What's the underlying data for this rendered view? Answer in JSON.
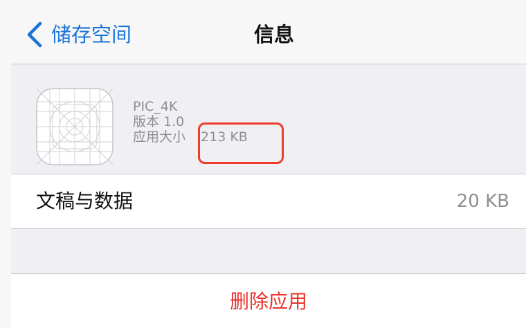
{
  "nav": {
    "back_label": "储存空间",
    "title": "信息"
  },
  "app": {
    "name": "PIC_4K",
    "version": "版本 1.0",
    "size_label": "应用大小",
    "size_value": "213 KB"
  },
  "documents": {
    "label": "文稿与数据",
    "value": "20 KB"
  },
  "actions": {
    "delete_label": "删除应用"
  },
  "icons": {
    "back": "chevron-left-icon",
    "app": "app-placeholder-icon"
  },
  "colors": {
    "accent": "#1a74d8",
    "destructive": "#e9322b",
    "highlight": "#ee3b2a",
    "secondary_text": "#8e8e93",
    "group_background": "#efeff4"
  }
}
